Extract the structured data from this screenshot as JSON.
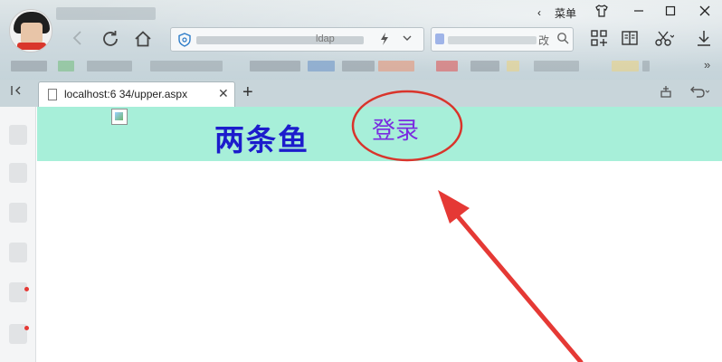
{
  "window": {
    "menu_label": "菜单",
    "menu_arrow": "‹",
    "skin_icon": "shirt-icon",
    "minimize_icon": "minimize-icon",
    "maximize_icon": "maximize-icon",
    "close_icon": "close-icon"
  },
  "toolbar": {
    "url_host_fragment": "ldap",
    "search_hint": "改"
  },
  "tabs": [
    {
      "title": "localhost:6   34/upper.aspx",
      "close_glyph": "✕"
    }
  ],
  "new_tab_glyph": "+",
  "page": {
    "banner_color": "#a7efd9",
    "site_title": "两条鱼",
    "login_label": "登录",
    "title_color": "#1c1ccc",
    "login_color": "#7a2be0"
  },
  "annotation": {
    "circle_color": "#d9342b",
    "arrow_color": "#e53935"
  }
}
